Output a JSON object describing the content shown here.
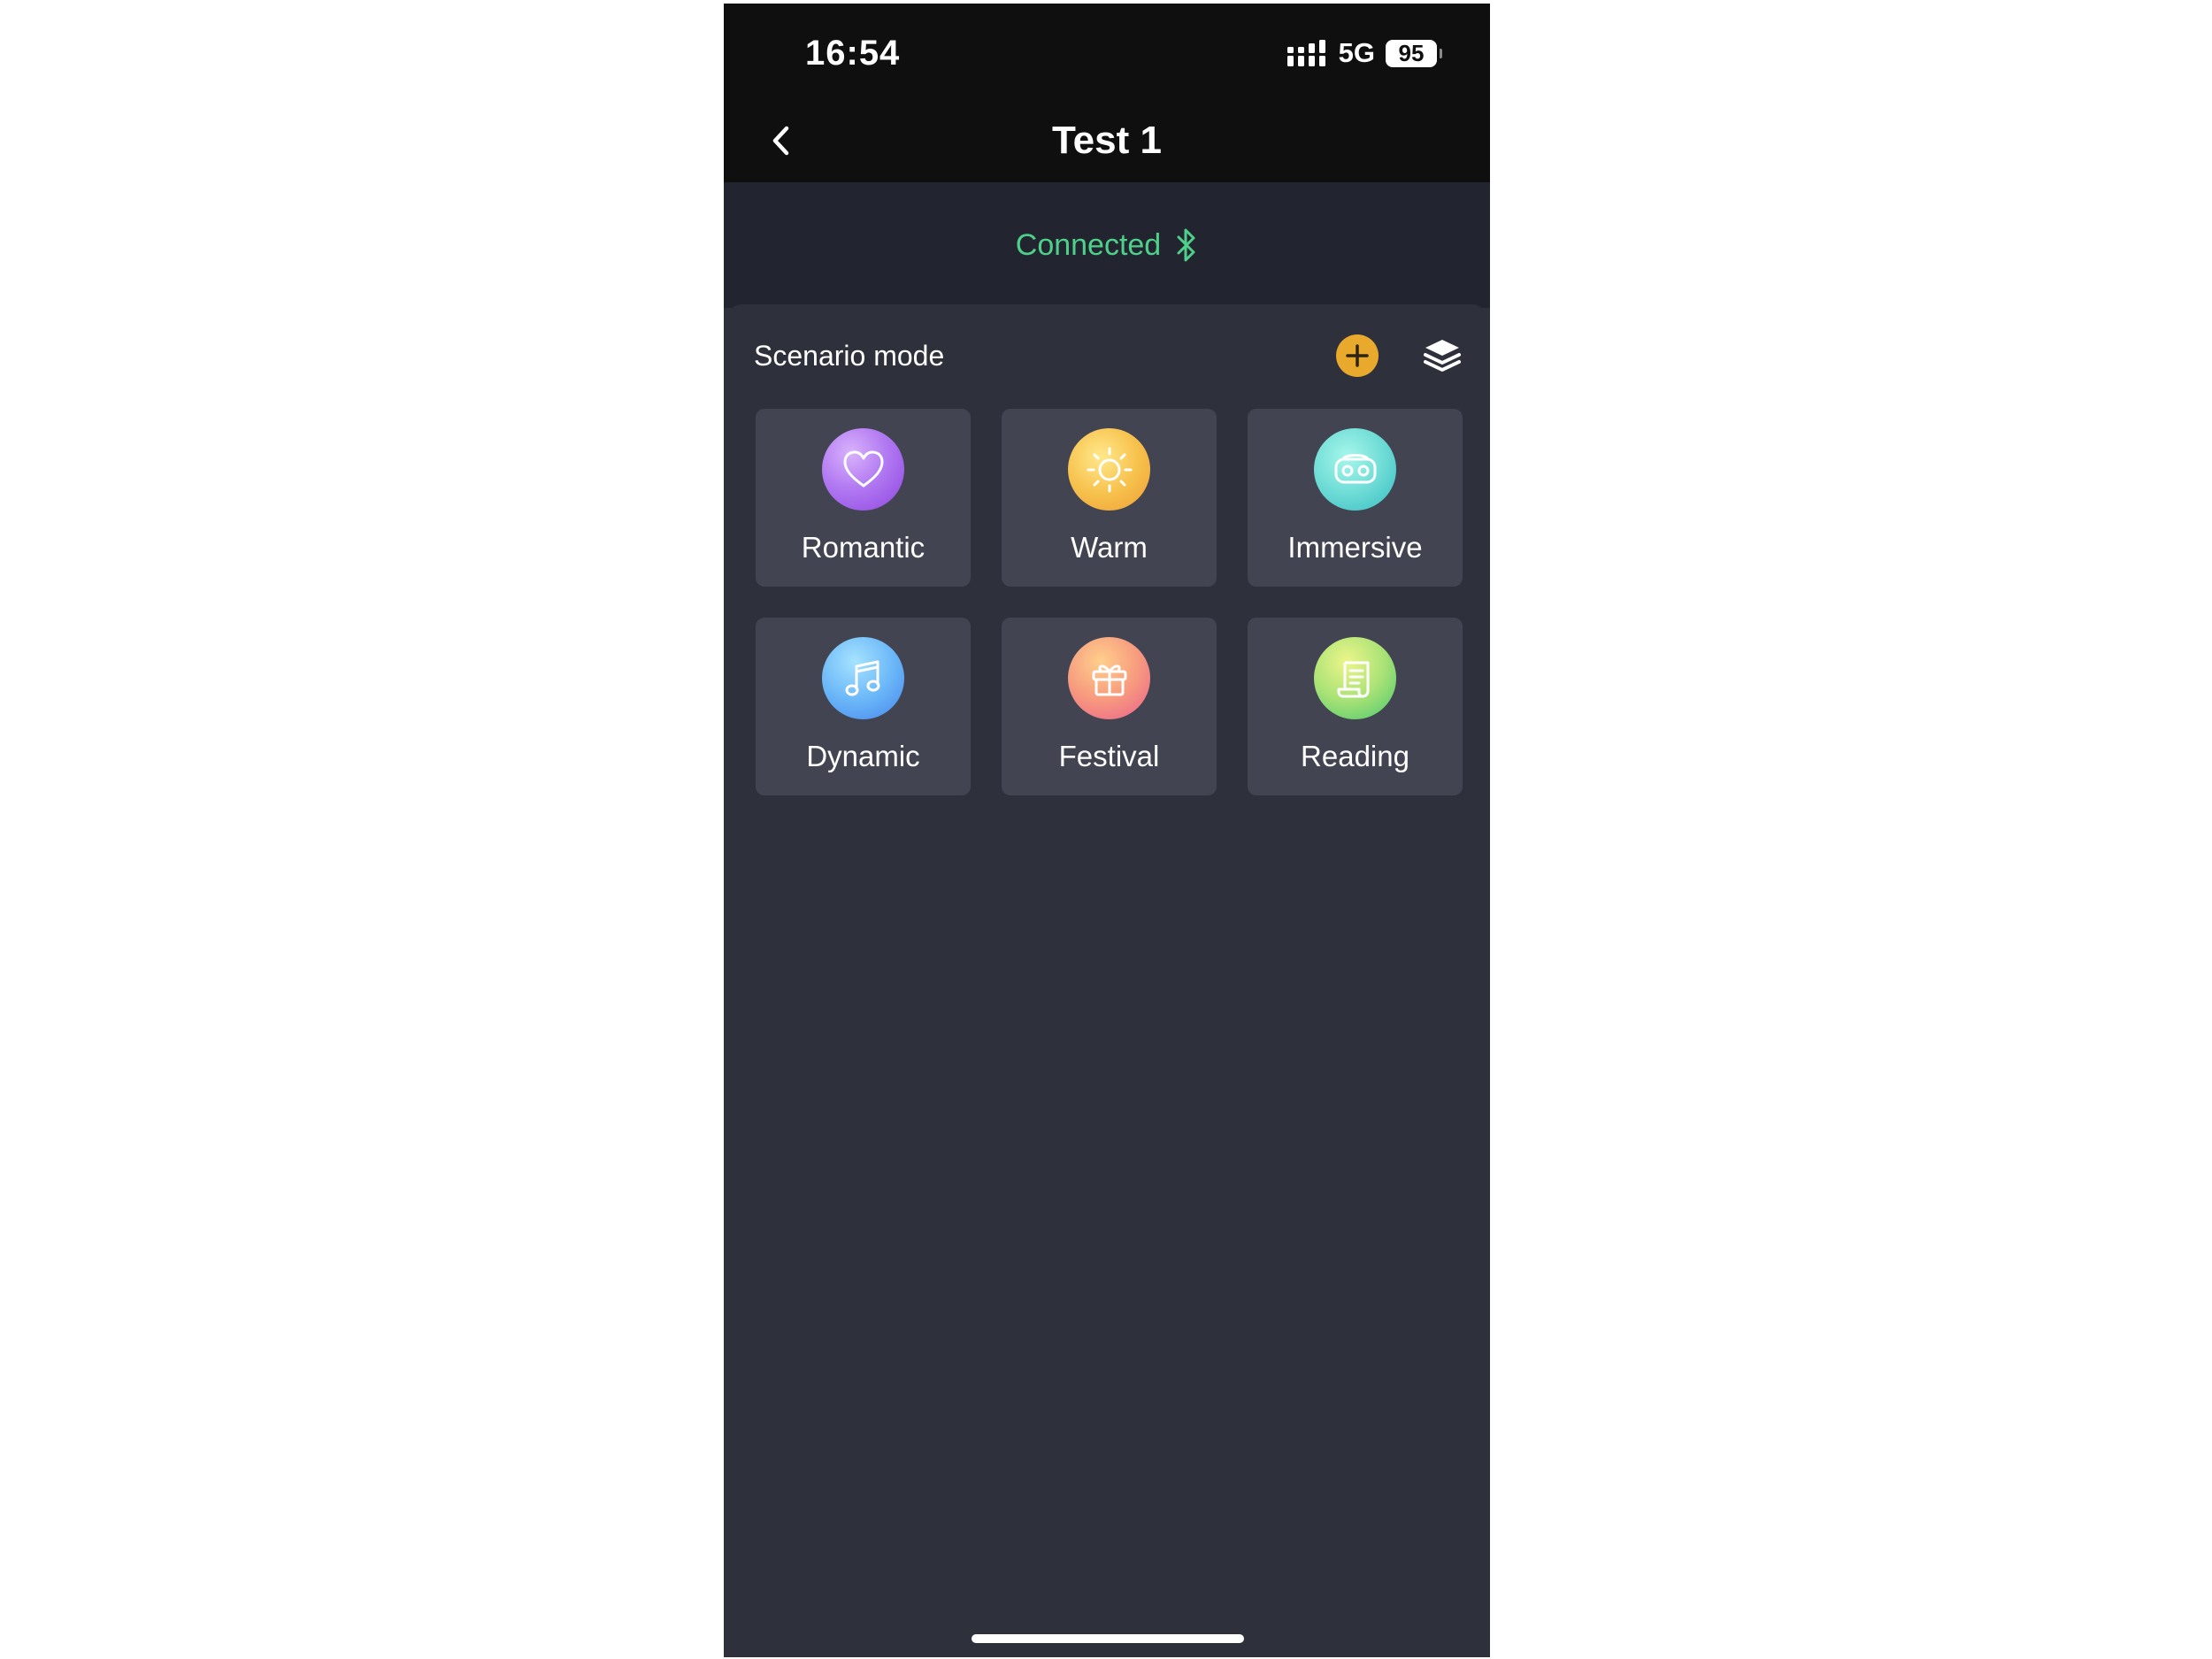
{
  "status_bar": {
    "time": "16:54",
    "network": "5G",
    "battery": "95"
  },
  "navbar": {
    "title": "Test 1"
  },
  "connection": {
    "status": "Connected",
    "color": "#4fd08a",
    "icon": "bluetooth-icon"
  },
  "scenario": {
    "title": "Scenario mode",
    "add_icon": "plus-icon",
    "layers_icon": "layers-icon",
    "accent": "#e8a92c",
    "modes": [
      {
        "label": "Romantic",
        "icon": "heart-icon",
        "gradient": [
          "#c99bf7",
          "#9c4ee6"
        ]
      },
      {
        "label": "Warm",
        "icon": "sun-icon",
        "gradient": [
          "#fde27a",
          "#f0a93a"
        ]
      },
      {
        "label": "Immersive",
        "icon": "vr-headset-icon",
        "gradient": [
          "#8ff2e2",
          "#3fc6c6"
        ]
      },
      {
        "label": "Dynamic",
        "icon": "music-note-icon",
        "gradient": [
          "#8fd8ff",
          "#4a8ff0"
        ]
      },
      {
        "label": "Festival",
        "icon": "gift-icon",
        "gradient": [
          "#ffc07a",
          "#ef6b8a"
        ]
      },
      {
        "label": "Reading",
        "icon": "book-icon",
        "gradient": [
          "#e4f27a",
          "#4fcf72"
        ]
      }
    ]
  }
}
